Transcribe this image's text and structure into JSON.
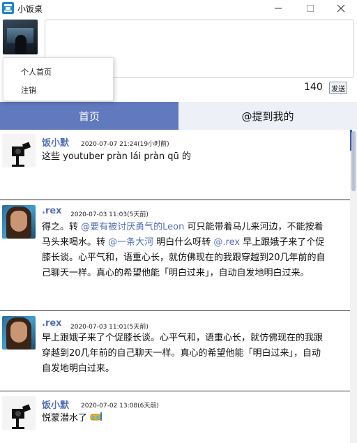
{
  "window": {
    "title": "小饭桌"
  },
  "composer": {
    "char_count": "140",
    "send_label": "发送"
  },
  "popup_menu": {
    "items": [
      {
        "label": "个人首页"
      },
      {
        "label": "注销"
      }
    ]
  },
  "tabs": [
    {
      "label": "首页",
      "active": true
    },
    {
      "label": "@提到我的",
      "active": false
    }
  ],
  "colors": {
    "accent": "#6179bd",
    "link": "#5470b6",
    "tab_inactive": "#edf0f7"
  },
  "feed": [
    {
      "name": "饭小默",
      "time": "2020-07-07 21:24(19小时前)",
      "avatar_icon": "camera-icon",
      "text": "这些 youtuber pràn lái pràn qū 的"
    },
    {
      "name": ".rex",
      "time": "2020-07-03 11:03(5天前)",
      "avatar_icon": "portrait-avatar",
      "parts": [
        "得之。转 ",
        "@要有被讨厌勇气的Leon",
        " 可只能带着马儿来河边，不能按着马头来喝水。转 ",
        "@一条大河",
        " 明白什么呀转 ",
        "@.rex",
        " 早上跟娥子来了个促膝长谈。心平气和，语重心长，就仿佛现在的我跟穿越到20几年前的自己聊天一样。真心的希望他能「明白过来」，自动自发地明白过来。"
      ]
    },
    {
      "name": ".rex",
      "time": "2020-07-03 11:01(5天前)",
      "avatar_icon": "portrait-avatar",
      "text": "早上跟娥子来了个促膝长谈。心平气和，语重心长，就仿佛现在的我跟穿越到20几年前的自己聊天一样。真心的希望他能「明白过来」，自动自发地明白过来。"
    },
    {
      "name": "饭小默",
      "time": "2020-07-02 13:08(6天前)",
      "avatar_icon": "camera-icon",
      "text": "悦蒙潜水了",
      "emoji": "diving-mask-icon"
    }
  ]
}
